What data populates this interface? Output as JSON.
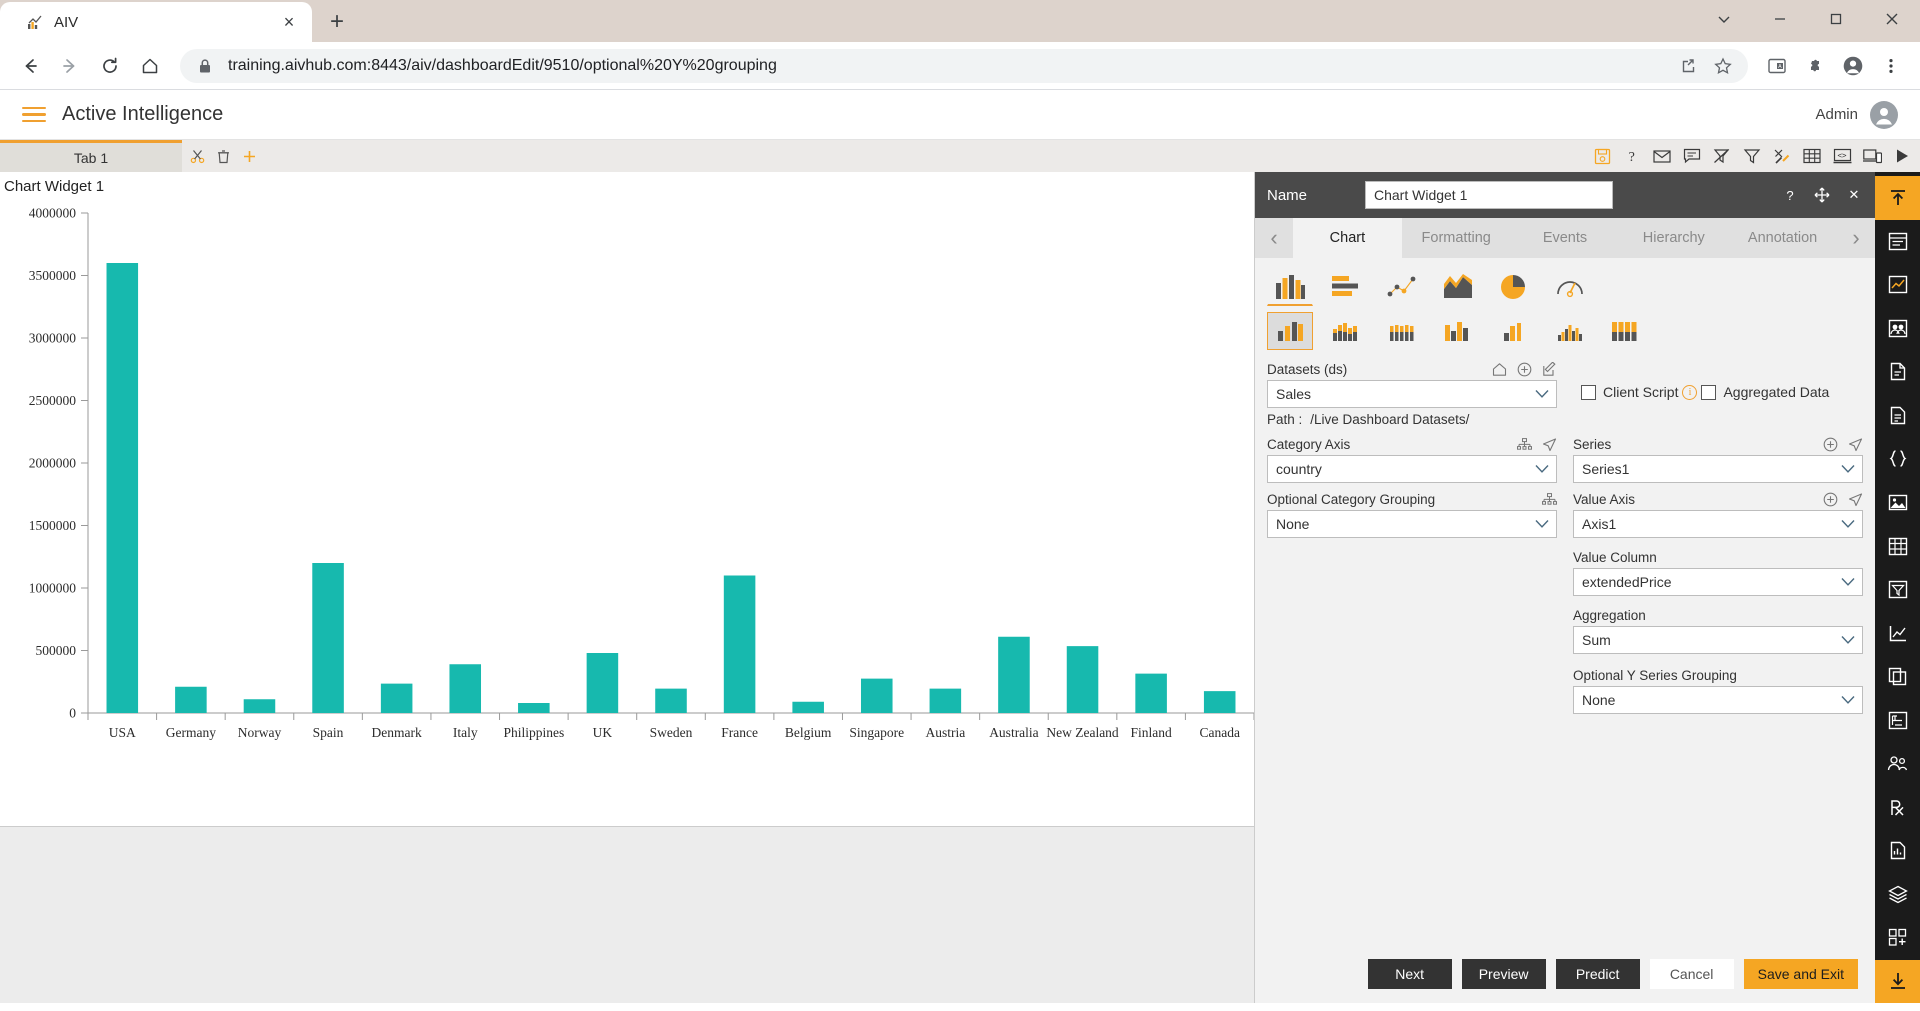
{
  "browser": {
    "tab": {
      "title": "AIV",
      "favicon": "chart-favicon",
      "close": "×"
    },
    "new_tab": "+",
    "window_controls": {
      "minimize": "–",
      "maximize": "☐",
      "close": "✕",
      "chevron": "∨"
    },
    "nav": {
      "back": "←",
      "forward": "→",
      "reload": "↻",
      "home": "⌂"
    },
    "omnibox": {
      "lock": "lock-icon",
      "url": "training.aivhub.com:8443/aiv/dashboardEdit/9510/optional%20Y%20grouping",
      "share": "share-icon",
      "star": "☆"
    },
    "toolbar_right": [
      "reading-list-icon",
      "extensions-icon",
      "profile-icon",
      "menu-icon"
    ]
  },
  "app": {
    "title": "Active Intelligence",
    "menu_icon": "hamburger-icon",
    "user": "Admin",
    "avatar_icon": "user-avatar-icon"
  },
  "dashboard_tabs": {
    "active_tab": "Tab 1",
    "tools": [
      "cut-icon",
      "delete-icon",
      "add-icon"
    ],
    "right_icons": [
      "save-icon",
      "help-icon",
      "mail-icon",
      "comment-icon",
      "clear-filter-icon",
      "filter-icon",
      "tools-icon",
      "table-icon",
      "code-icon",
      "devices-icon",
      "play-icon"
    ]
  },
  "widget": {
    "title": "Chart Widget 1"
  },
  "chart_data": {
    "type": "bar",
    "title": "",
    "xlabel": "",
    "ylabel": "",
    "ylim": [
      0,
      4000000
    ],
    "ytick_values": [
      0,
      500000,
      1000000,
      1500000,
      2000000,
      2500000,
      3000000,
      3500000,
      4000000
    ],
    "ytick_labels": [
      "0",
      "500000",
      "1000000",
      "1500000",
      "2000000",
      "2500000",
      "3000000",
      "3500000",
      "4000000"
    ],
    "grid": false,
    "legend": false,
    "series_color": "#17b9ae",
    "categories": [
      "USA",
      "Germany",
      "Norway",
      "Spain",
      "Denmark",
      "Italy",
      "Philippines",
      "UK",
      "Sweden",
      "France",
      "Belgium",
      "Singapore",
      "Austria",
      "Australia",
      "New Zealand",
      "Finland",
      "Canada"
    ],
    "series": [
      {
        "name": "Series1",
        "values": [
          3600000,
          210000,
          110000,
          1200000,
          235000,
          390000,
          80000,
          480000,
          195000,
          1100000,
          90000,
          275000,
          195000,
          610000,
          535000,
          315000,
          175000
        ]
      }
    ]
  },
  "panel": {
    "name_label": "Name",
    "name_value": "Chart Widget 1",
    "name_placeholder": "Chart Widget 1",
    "header_icons": {
      "help": "?",
      "move": "move-icon",
      "close": "✕"
    },
    "tabs": [
      {
        "label": "Chart",
        "active": true
      },
      {
        "label": "Formatting",
        "active": false
      },
      {
        "label": "Events",
        "active": false
      },
      {
        "label": "Hierarchy",
        "active": false
      },
      {
        "label": "Annotation",
        "active": false
      }
    ],
    "tab_prev": "‹",
    "tab_next": "›",
    "chart_types_row1": [
      {
        "name": "column-chart-icon",
        "selected": true
      },
      {
        "name": "bar-chart-icon",
        "selected": false
      },
      {
        "name": "scatter-chart-icon",
        "selected": false
      },
      {
        "name": "area-chart-icon",
        "selected": false
      },
      {
        "name": "pie-chart-icon",
        "selected": false
      },
      {
        "name": "gauge-chart-icon",
        "selected": false
      }
    ],
    "chart_types_row2": [
      {
        "name": "clustered-column-icon",
        "selected": true
      },
      {
        "name": "stacked-column-icon",
        "selected": false
      },
      {
        "name": "stacked-100-column-icon",
        "selected": false
      },
      {
        "name": "grouped-column-icon",
        "selected": false
      },
      {
        "name": "overlapped-column-icon",
        "selected": false
      },
      {
        "name": "multi-series-column-icon",
        "selected": false
      },
      {
        "name": "range-column-icon",
        "selected": false
      }
    ],
    "datasets": {
      "label": "Datasets (ds)",
      "value": "Sales",
      "icons": [
        "home-icon",
        "add-circle-icon",
        "edit-icon"
      ],
      "path_label": "Path :",
      "path_value": "/Live Dashboard Datasets/"
    },
    "client_script": {
      "label": "Client Script",
      "checked": false,
      "info": "i"
    },
    "aggregated_data": {
      "label": "Aggregated Data",
      "checked": false
    },
    "category_axis": {
      "label": "Category Axis",
      "value": "country",
      "icons": [
        "hierarchy-icon",
        "navigate-icon"
      ]
    },
    "optional_category_grouping": {
      "label": "Optional Category Grouping",
      "value": "None",
      "icons": [
        "hierarchy-icon"
      ]
    },
    "series": {
      "label": "Series",
      "value": "Series1",
      "icons": [
        "add-circle-icon",
        "navigate-icon"
      ]
    },
    "value_axis": {
      "label": "Value Axis",
      "value": "Axis1",
      "icons": [
        "add-circle-icon",
        "navigate-icon"
      ]
    },
    "value_column": {
      "label": "Value Column",
      "value": "extendedPrice"
    },
    "aggregation": {
      "label": "Aggregation",
      "value": "Sum"
    },
    "optional_y_series_grouping": {
      "label": "Optional Y Series Grouping",
      "value": "None"
    },
    "buttons": {
      "next": "Next",
      "preview": "Preview",
      "predict": "Predict",
      "cancel": "Cancel",
      "save_and_exit": "Save and Exit"
    }
  },
  "rail": {
    "icons": [
      "collapse-up-icon",
      "panel-icon",
      "analytics-icon",
      "group-icon",
      "document-icon",
      "file-icon",
      "braces-icon",
      "image-icon",
      "grid-icon",
      "filter-list-icon",
      "chart-line-icon",
      "copy-icon",
      "folder-tree-icon",
      "users-icon",
      "rx-icon",
      "report-icon",
      "layers-icon",
      "apps-icon",
      "download-icon"
    ]
  },
  "colors": {
    "accent": "#f5a623",
    "chart_series": "#17b9ae",
    "panel_bg": "#f2f2f2",
    "dark_bar": "#4a4a4a"
  }
}
